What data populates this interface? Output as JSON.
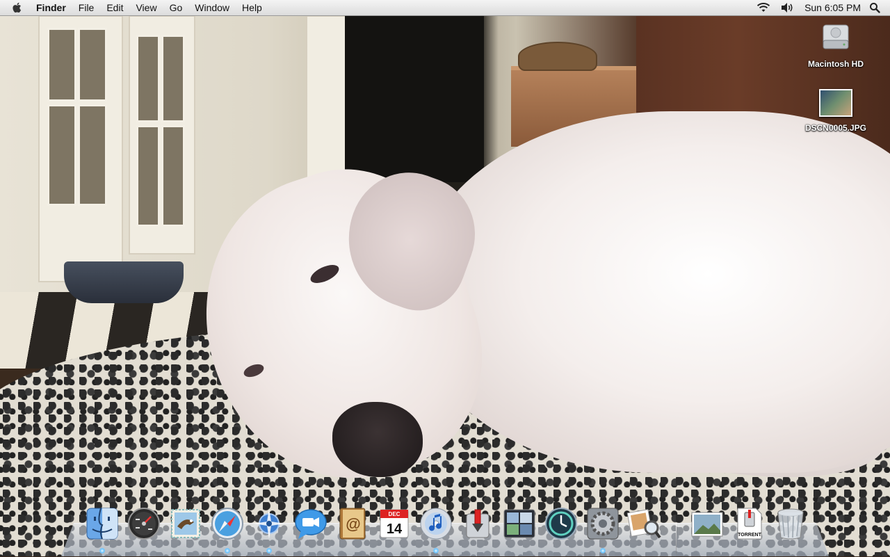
{
  "menubar": {
    "app_name": "Finder",
    "items": [
      "File",
      "Edit",
      "View",
      "Go",
      "Window",
      "Help"
    ],
    "clock": "Sun 6:05 PM",
    "status_icons": [
      "wifi-icon",
      "volume-icon",
      "spotlight-icon"
    ]
  },
  "desktop": {
    "icons": [
      {
        "label": "Macintosh HD",
        "icon": "hard-drive-icon"
      },
      {
        "label": "DSCN0005.JPG",
        "icon": "image-file-icon"
      }
    ]
  },
  "dock": {
    "apps": [
      {
        "name": "Finder",
        "icon": "finder-icon",
        "running": true
      },
      {
        "name": "Dashboard",
        "icon": "dashboard-icon",
        "running": false
      },
      {
        "name": "Mail",
        "icon": "mail-icon",
        "running": false
      },
      {
        "name": "Safari",
        "icon": "safari-icon",
        "running": true
      },
      {
        "name": "Network",
        "icon": "network-icon",
        "running": true
      },
      {
        "name": "iChat",
        "icon": "ichat-icon",
        "running": false
      },
      {
        "name": "Address Book",
        "icon": "address-book-icon",
        "running": false
      },
      {
        "name": "iCal",
        "icon": "ical-icon",
        "running": false,
        "month": "DEC",
        "day": "14"
      },
      {
        "name": "iTunes",
        "icon": "itunes-icon",
        "running": true
      },
      {
        "name": "Transmission",
        "icon": "transmission-icon",
        "running": false
      },
      {
        "name": "Spaces",
        "icon": "spaces-icon",
        "running": false
      },
      {
        "name": "Time Machine",
        "icon": "time-machine-icon",
        "running": false
      },
      {
        "name": "System Preferences",
        "icon": "system-preferences-icon",
        "running": true
      },
      {
        "name": "Preview",
        "icon": "preview-icon",
        "running": false
      }
    ],
    "stacks": [
      {
        "name": "Pictures",
        "icon": "picture-stack-icon"
      },
      {
        "name": "Torrent",
        "icon": "torrent-file-icon",
        "label": "TORRENT"
      },
      {
        "name": "Trash",
        "icon": "trash-icon"
      }
    ]
  }
}
